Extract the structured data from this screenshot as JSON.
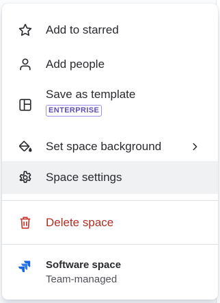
{
  "menu": {
    "items": [
      {
        "label": "Add to starred",
        "icon": "star-icon"
      },
      {
        "label": "Add people",
        "icon": "person-icon"
      },
      {
        "label": "Save as template",
        "icon": "template-icon",
        "badge": "ENTERPRISE"
      },
      {
        "label": "Set space background",
        "icon": "paint-bucket-icon",
        "submenu_icon": "chevron-right-icon"
      },
      {
        "label": "Space settings",
        "icon": "gear-icon",
        "hovered": true
      },
      {
        "label": "Delete space",
        "icon": "trash-icon",
        "destructive": true
      }
    ],
    "footer": {
      "title": "Software space",
      "subtitle": "Team-managed",
      "icon": "jira-logo-icon"
    }
  },
  "colors": {
    "text": "#292a2e",
    "danger": "#ae2e24",
    "badge": "#5e4db2",
    "hover_bg": "#f0f1f3",
    "jira_blue": "#1868db"
  }
}
